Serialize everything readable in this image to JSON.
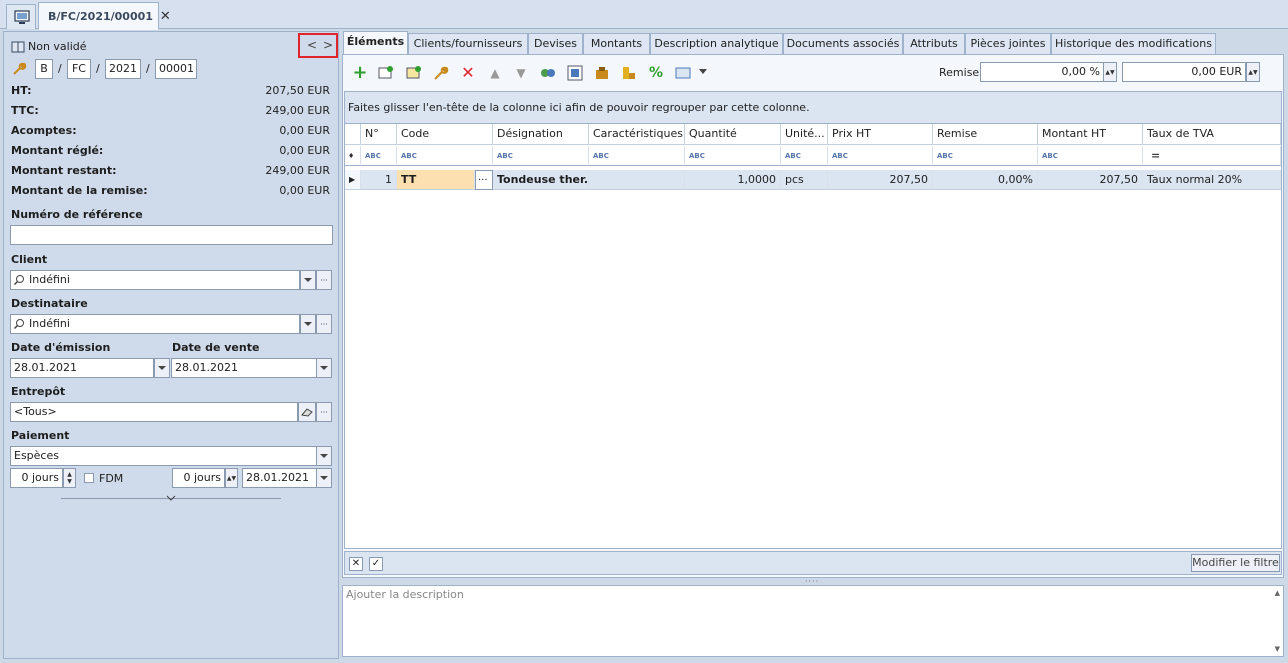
{
  "document_tab": {
    "title": "B/FC/2021/00001",
    "close": "✕"
  },
  "left": {
    "status": "Non validé",
    "nav_prev": "<",
    "nav_next": ">",
    "number_parts": [
      "B",
      "FC",
      "2021",
      "00001"
    ],
    "separator": "/",
    "totals": [
      {
        "label": "HT:",
        "value": "207,50 EUR"
      },
      {
        "label": "TTC:",
        "value": "249,00 EUR"
      },
      {
        "label": "Acomptes:",
        "value": "0,00 EUR"
      },
      {
        "label": "Montant réglé:",
        "value": "0,00 EUR"
      },
      {
        "label": "Montant restant:",
        "value": "249,00 EUR"
      },
      {
        "label": "Montant de la remise:",
        "value": "0,00 EUR"
      }
    ],
    "ref_label": "Numéro de référence",
    "ref_value": "",
    "client_label": "Client",
    "client_value": "Indéfini",
    "recipient_label": "Destinataire",
    "recipient_value": "Indéfini",
    "issue_date_label": "Date d'émission",
    "issue_date": "28.01.2021",
    "sale_date_label": "Date de vente",
    "sale_date": "28.01.2021",
    "warehouse_label": "Entrepôt",
    "warehouse_value": "<Tous>",
    "payment_label": "Paiement",
    "payment_value": "Espèces",
    "days1": "0 jours",
    "fdm_label": "FDM",
    "days2": "0 jours",
    "due_date": "28.01.2021"
  },
  "tabs": [
    "Éléments",
    "Clients/fournisseurs",
    "Devises",
    "Montants",
    "Description analytique",
    "Documents associés",
    "Attributs",
    "Pièces jointes",
    "Historique des modifications"
  ],
  "toolbar": {
    "remise_label": "Remise:",
    "remise_pct": "0,00 %",
    "remise_amount": "0,00 EUR"
  },
  "grid": {
    "group_hint": "Faites glisser l'en-tête de la colonne ici afin de pouvoir regrouper par cette colonne.",
    "columns": [
      "N°",
      "Code",
      "Désignation",
      "Caractéristiques",
      "Quantité",
      "Unité...",
      "Prix HT",
      "Remise",
      "Montant HT",
      "Taux de TVA"
    ],
    "filter_glyph": "ABC",
    "filter_eq": "=",
    "row": {
      "no": "1",
      "code": "TT",
      "designation": "Tondeuse ther...",
      "characteristics": "",
      "quantity": "1,0000",
      "unit": "pcs",
      "price": "207,50",
      "discount": "0,00%",
      "amount": "207,50",
      "vat": "Taux normal 20%"
    },
    "modify_filter": "Modifier le filtre"
  },
  "description_placeholder": "Ajouter la description",
  "colors": {
    "accent_red": "#e0242b",
    "panel": "#cfdbea",
    "grid_row": "#dbe5f1"
  }
}
